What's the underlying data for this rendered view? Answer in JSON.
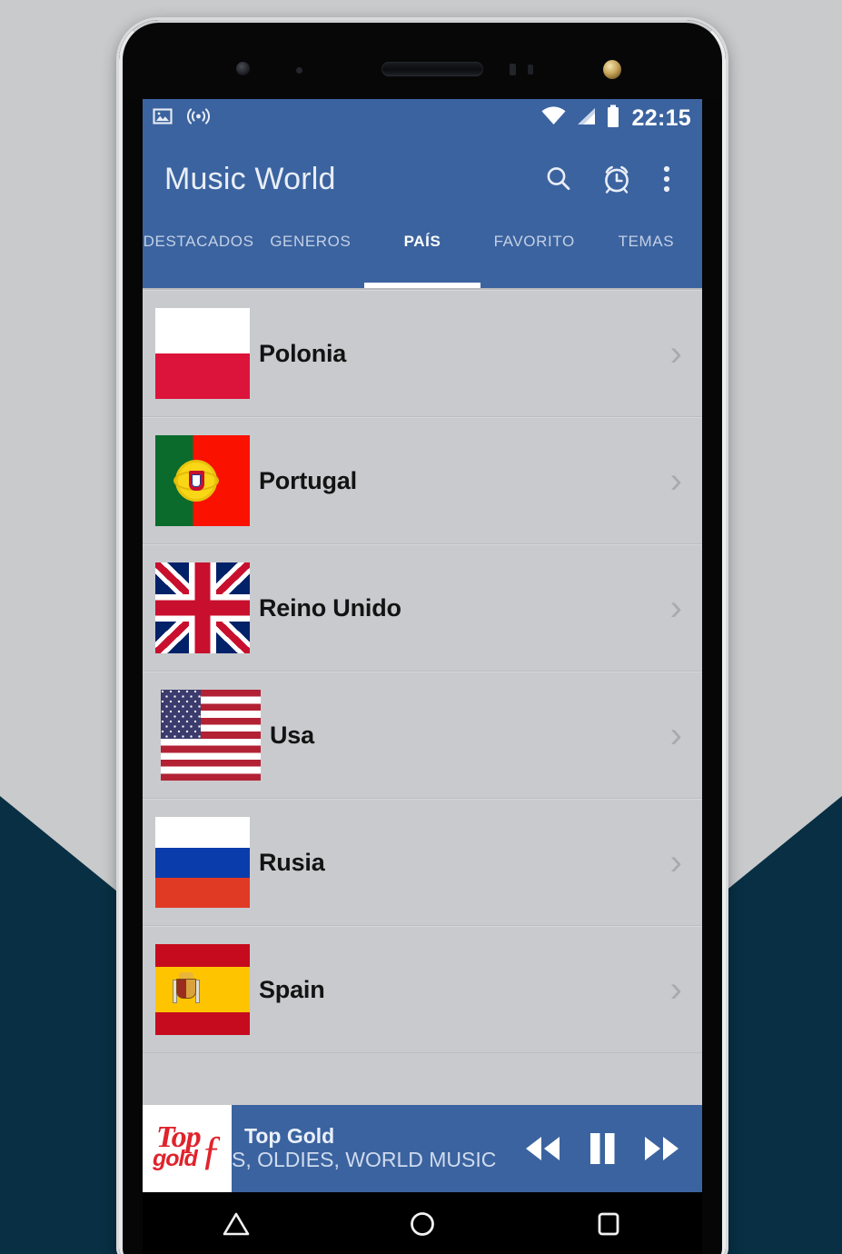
{
  "status_bar": {
    "icons": [
      "image-icon",
      "cast-icon",
      "wifi-icon",
      "signal-icon",
      "battery-icon"
    ],
    "time": "22:15"
  },
  "app_bar": {
    "title": "Music World",
    "actions": [
      {
        "name": "search-icon",
        "label": "Search"
      },
      {
        "name": "alarm-icon",
        "label": "Sleep timer"
      },
      {
        "name": "overflow-menu-icon",
        "label": "More options"
      }
    ]
  },
  "tabs": {
    "items": [
      {
        "label": "DESTACADOS",
        "active": false
      },
      {
        "label": "GENEROS",
        "active": false
      },
      {
        "label": "PAÍS",
        "active": true
      },
      {
        "label": "FAVORITO",
        "active": false
      },
      {
        "label": "TEMAS",
        "active": false
      }
    ],
    "active_index": 2
  },
  "countries": [
    {
      "name": "Polonia",
      "flag": "poland",
      "chevron": "›"
    },
    {
      "name": "Portugal",
      "flag": "portugal",
      "chevron": "›"
    },
    {
      "name": "Reino Unido",
      "flag": "united-kingdom",
      "chevron": "›"
    },
    {
      "name": "Usa",
      "flag": "usa",
      "chevron": "›"
    },
    {
      "name": "Rusia",
      "flag": "russia",
      "chevron": "›"
    },
    {
      "name": "Spain",
      "flag": "spain",
      "chevron": "›"
    }
  ],
  "player": {
    "logo_line1": "Top",
    "logo_line2": "gold",
    "logo_swash": "ƒ",
    "title": "Top Gold",
    "subtitle": "S, OLDIES, WORLD MUSIC",
    "controls": [
      {
        "name": "previous-button",
        "label": "Previous"
      },
      {
        "name": "pause-button",
        "label": "Pause"
      },
      {
        "name": "next-button",
        "label": "Next"
      }
    ]
  },
  "nav_bar": {
    "buttons": [
      {
        "name": "back-button",
        "label": "Back"
      },
      {
        "name": "home-button",
        "label": "Home"
      },
      {
        "name": "recents-button",
        "label": "Recents"
      }
    ]
  },
  "colors": {
    "primary": "#3b639f",
    "list_background": "#c9cacd",
    "accent_navy": "#082f43",
    "page_background": "#c9cacc"
  }
}
